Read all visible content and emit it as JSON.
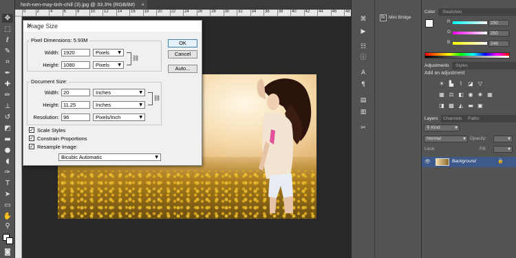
{
  "document": {
    "tab_title": "hinh-nen-may-tinh-chill (3).jpg @ 33.3% (RGB/8#)",
    "close_symbol": "×",
    "ruler_ticks": [
      "0",
      "2",
      "4",
      "6",
      "8",
      "10",
      "12",
      "14",
      "16",
      "18",
      "20",
      "22",
      "24",
      "26",
      "28",
      "30",
      "32",
      "34",
      "36",
      "38",
      "40",
      "42",
      "44",
      "46",
      "48"
    ]
  },
  "image_size_dialog": {
    "title": "Image Size",
    "close_symbol": "✕",
    "pixel_dimensions_label": "Pixel Dimensions:",
    "pixel_dimensions_value": "5.93M",
    "width_label": "Width:",
    "width_px_value": "1920",
    "width_px_unit": "Pixels",
    "height_label": "Height:",
    "height_px_value": "1080",
    "height_px_unit": "Pixels",
    "document_size_label": "Document Size:",
    "doc_width_value": "20",
    "doc_width_unit": "Inches",
    "doc_height_value": "11.25",
    "doc_height_unit": "Inches",
    "resolution_label": "Resolution:",
    "resolution_value": "96",
    "resolution_unit": "Pixels/Inch",
    "scale_styles_label": "Scale Styles",
    "constrain_proportions_label": "Constrain Proportions",
    "resample_image_label": "Resample Image:",
    "resample_method": "Bicubic Automatic",
    "ok_label": "OK",
    "cancel_label": "Cancel",
    "auto_label": "Auto...",
    "scale_styles_checked": true,
    "constrain_checked": true,
    "resample_checked": true
  },
  "mini_bridge": {
    "label": "Mini Bridge",
    "icon_text": "Br"
  },
  "color_panel": {
    "tabs": [
      "Color",
      "Swatches"
    ],
    "r_label": "R",
    "g_label": "G",
    "b_label": "B",
    "r_value": "250",
    "g_value": "250",
    "b_value": "248"
  },
  "adjustments_panel": {
    "tabs": [
      "Adjustments",
      "Styles"
    ],
    "heading": "Add an adjustment"
  },
  "layers_panel": {
    "tabs": [
      "Layers",
      "Channels",
      "Paths"
    ],
    "kind_label": "Kind",
    "blend_mode": "Normal",
    "opacity_label": "Opacity:",
    "lock_label": "Lock:",
    "fill_label": "Fill:",
    "layer_name": "Background"
  },
  "colors": {
    "ui_bg": "#535353",
    "canvas_bg": "#282828",
    "layer_selected": "#3d5a8a",
    "dialog_bg": "#f0f0f0"
  }
}
